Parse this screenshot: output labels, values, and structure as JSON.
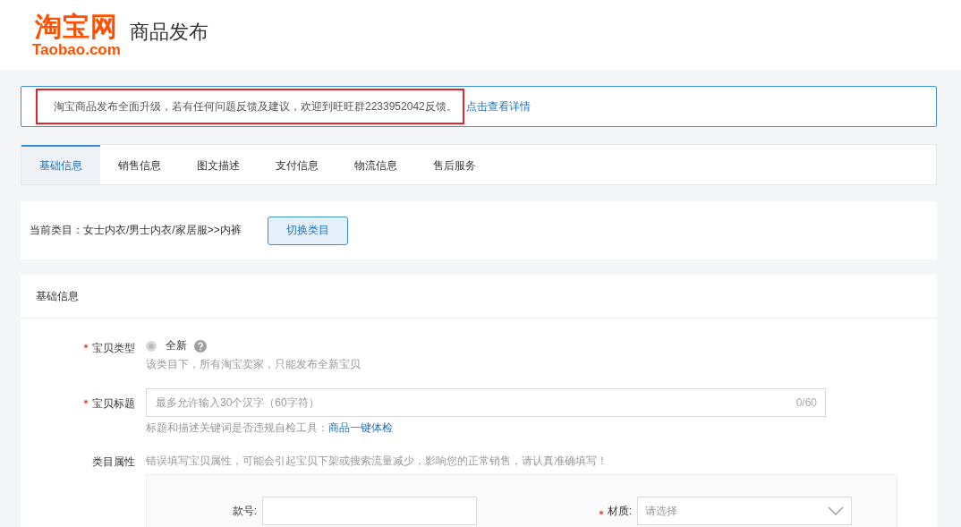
{
  "header": {
    "logo": {
      "mark": "淘宝网",
      "domain": "Taobao.com"
    },
    "page_title": "商品发布"
  },
  "notice": {
    "text": "淘宝商品发布全面升级，若有任何问题反馈及建议，欢迎到旺旺群2233952042反馈。",
    "link": "点击查看详情",
    "highlighted": true
  },
  "tabs": [
    {
      "label": "基础信息",
      "selected": true
    },
    {
      "label": "销售信息",
      "selected": false
    },
    {
      "label": "图文描述",
      "selected": false
    },
    {
      "label": "支付信息",
      "selected": false
    },
    {
      "label": "物流信息",
      "selected": false
    },
    {
      "label": "售后服务",
      "selected": false
    }
  ],
  "category": {
    "text": "当前类目：女士内衣/男士内衣/家居服>>内裤",
    "button": "切换类目"
  },
  "section": {
    "title": "基础信息",
    "fields": [
      {
        "kind": "radio",
        "label": "宝贝类型",
        "required": true,
        "options": [
          {
            "label": "全新",
            "selected": true,
            "disabled": true
          }
        ],
        "help": true,
        "hint": "该类目下，所有淘宝卖家，只能发布全新宝贝"
      },
      {
        "kind": "text",
        "label": "宝贝标题",
        "required": true,
        "placeholder": "最多允许输入30个汉字（60字符）",
        "counter": "0/60",
        "hint": "标题和描述关键词是否违规自检工具：",
        "hint_link": "商品一键体检"
      },
      {
        "kind": "attributes",
        "label": "类目属性",
        "required": false,
        "hint": "错误填写宝贝属性，可能会引起宝贝下架或搜索流量减少，影响您的正常销售，请认真准确填写！",
        "attributes": [
          {
            "kind": "text",
            "label": "款号:",
            "required": false
          },
          {
            "kind": "select",
            "label": "材质:",
            "required": true,
            "placeholder": "请选择"
          }
        ]
      }
    ]
  }
}
